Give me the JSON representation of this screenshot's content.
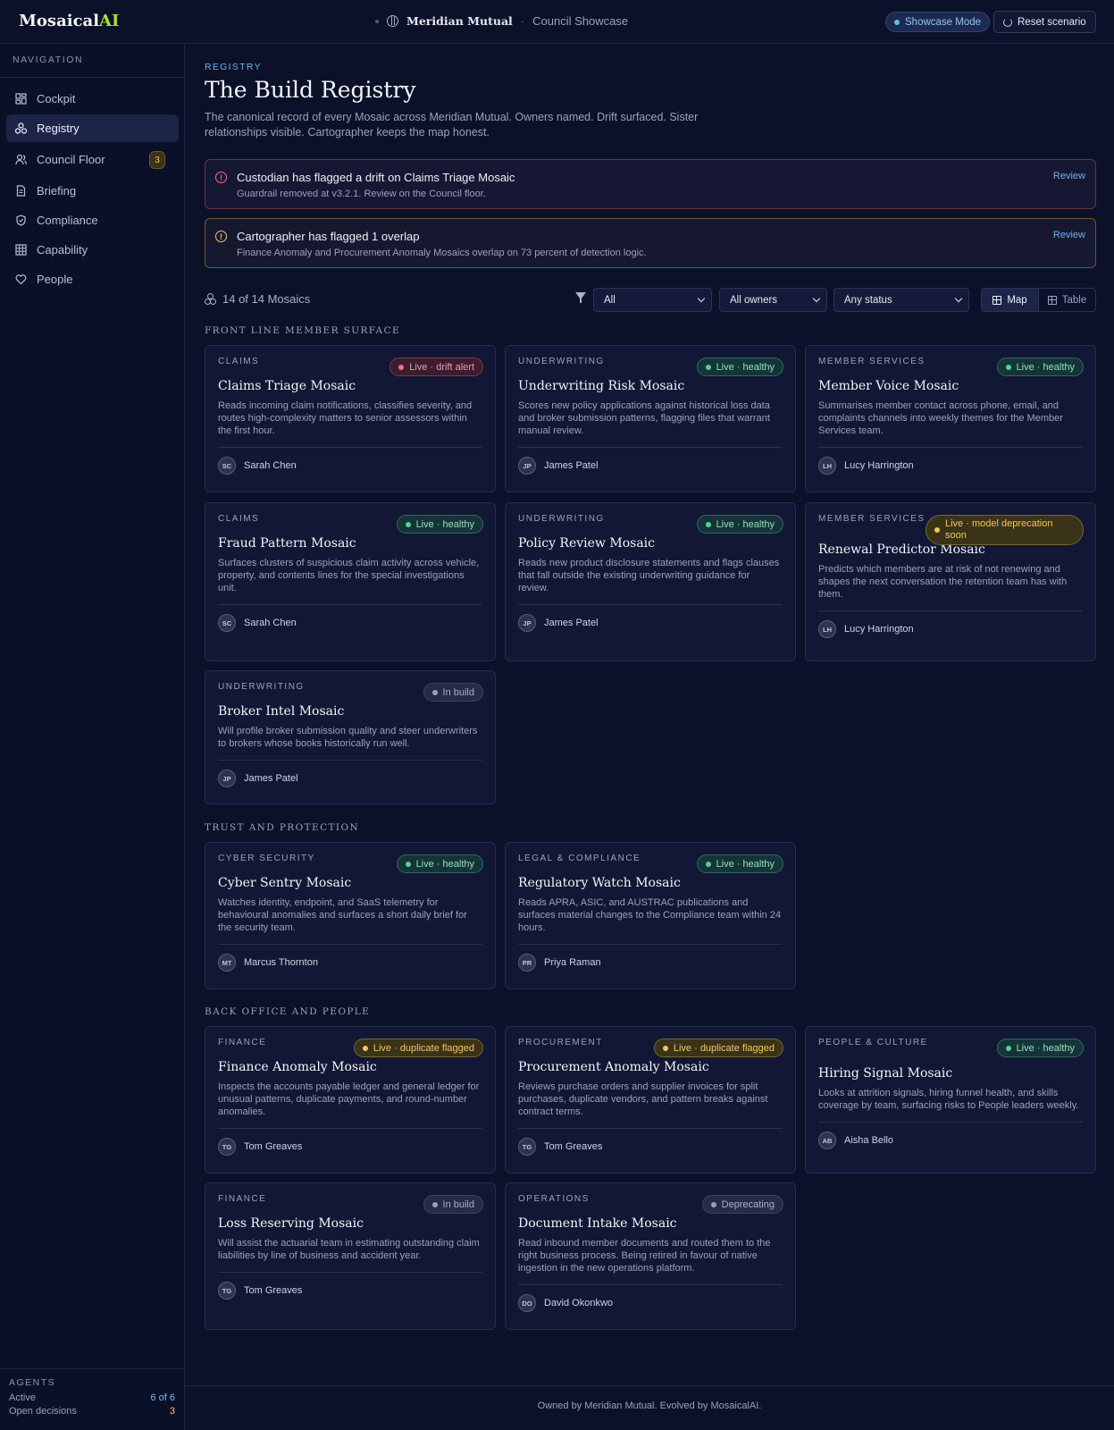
{
  "app": {
    "logo_main": "Mosaical",
    "logo_accent": "AI",
    "org": "Meridian Mutual",
    "section": "Council Showcase",
    "showcase_label": "Showcase Mode",
    "reset_label": "Reset scenario"
  },
  "sidebar": {
    "heading": "NAVIGATION",
    "items": [
      {
        "label": "Cockpit",
        "icon": "dashboard-icon"
      },
      {
        "label": "Registry",
        "icon": "network-icon"
      },
      {
        "label": "Council Floor",
        "icon": "users-icon",
        "badge": "3"
      },
      {
        "label": "Briefing",
        "icon": "document-icon"
      },
      {
        "label": "Compliance",
        "icon": "shield-icon"
      },
      {
        "label": "Capability",
        "icon": "grid-icon"
      },
      {
        "label": "People",
        "icon": "heart-icon"
      }
    ],
    "agents": {
      "heading": "AGENTS",
      "active_label": "Active",
      "active_value": "6 of 6",
      "open_label": "Open decisions",
      "open_value": "3"
    }
  },
  "page": {
    "kicker": "REGISTRY",
    "title": "The Build Registry",
    "subtitle": "The canonical record of every Mosaic across Meridian Mutual. Owners named. Drift surfaced. Sister relationships visible. Cartographer keeps the map honest."
  },
  "alerts": [
    {
      "title": "Custodian has flagged a drift on Claims Triage Mosaic",
      "detail": "Guardrail removed at v3.2.1. Review on the Council floor.",
      "action": "Review"
    },
    {
      "title": "Cartographer has flagged 1 overlap",
      "detail": "Finance Anomaly and Procurement Anomaly Mosaics overlap on 73 percent of detection logic.",
      "action": "Review"
    }
  ],
  "toolbar": {
    "count": "14 of 14 Mosaics",
    "filter_domain": "All",
    "filter_owner": "All owners",
    "filter_status": "Any status",
    "view_map": "Map",
    "view_table": "Table"
  },
  "sections": [
    "FRONT LINE MEMBER SURFACE",
    "TRUST AND PROTECTION",
    "BACK OFFICE AND PEOPLE"
  ],
  "cards": [
    {
      "category": "CLAIMS",
      "status": "Live · drift alert",
      "name": "Claims Triage Mosaic",
      "desc": "Reads incoming claim notifications, classifies severity, and routes high-complexity matters to senior assessors within the first hour.",
      "initials": "SC",
      "owner": "Sarah Chen"
    },
    {
      "category": "UNDERWRITING",
      "status": "Live · healthy",
      "name": "Underwriting Risk Mosaic",
      "desc": "Scores new policy applications against historical loss data and broker submission patterns, flagging files that warrant manual review.",
      "initials": "JP",
      "owner": "James Patel"
    },
    {
      "category": "MEMBER SERVICES",
      "status": "Live · healthy",
      "name": "Member Voice Mosaic",
      "desc": "Summarises member contact across phone, email, and complaints channels into weekly themes for the Member Services team.",
      "initials": "LH",
      "owner": "Lucy Harrington"
    },
    {
      "category": "CLAIMS",
      "status": "Live · healthy",
      "name": "Fraud Pattern Mosaic",
      "desc": "Surfaces clusters of suspicious claim activity across vehicle, property, and contents lines for the special investigations unit.",
      "initials": "SC",
      "owner": "Sarah Chen"
    },
    {
      "category": "UNDERWRITING",
      "status": "Live · healthy",
      "name": "Policy Review Mosaic",
      "desc": "Reads new product disclosure statements and flags clauses that fall outside the existing underwriting guidance for review.",
      "initials": "JP",
      "owner": "James Patel"
    },
    {
      "category": "MEMBER SERVICES",
      "status": "Live · model deprecation soon",
      "name": "Renewal Predictor Mosaic",
      "desc": "Predicts which members are at risk of not renewing and shapes the next conversation the retention team has with them.",
      "initials": "LH",
      "owner": "Lucy Harrington"
    },
    {
      "category": "UNDERWRITING",
      "status": "In build",
      "name": "Broker Intel Mosaic",
      "desc": "Will profile broker submission quality and steer underwriters to brokers whose books historically run well.",
      "initials": "JP",
      "owner": "James Patel"
    },
    {
      "category": "CYBER SECURITY",
      "status": "Live · healthy",
      "name": "Cyber Sentry Mosaic",
      "desc": "Watches identity, endpoint, and SaaS telemetry for behavioural anomalies and surfaces a short daily brief for the security team.",
      "initials": "MT",
      "owner": "Marcus Thornton"
    },
    {
      "category": "LEGAL & COMPLIANCE",
      "status": "Live · healthy",
      "name": "Regulatory Watch Mosaic",
      "desc": "Reads APRA, ASIC, and AUSTRAC publications and surfaces material changes to the Compliance team within 24 hours.",
      "initials": "PR",
      "owner": "Priya Raman"
    },
    {
      "category": "FINANCE",
      "status": "Live · duplicate flagged",
      "name": "Finance Anomaly Mosaic",
      "desc": "Inspects the accounts payable ledger and general ledger for unusual patterns, duplicate payments, and round-number anomalies.",
      "initials": "TG",
      "owner": "Tom Greaves"
    },
    {
      "category": "PROCUREMENT",
      "status": "Live · duplicate flagged",
      "name": "Procurement Anomaly Mosaic",
      "desc": "Reviews purchase orders and supplier invoices for split purchases, duplicate vendors, and pattern breaks against contract terms.",
      "initials": "TG",
      "owner": "Tom Greaves"
    },
    {
      "category": "PEOPLE & CULTURE",
      "status": "Live · healthy",
      "name": "Hiring Signal Mosaic",
      "desc": "Looks at attrition signals, hiring funnel health, and skills coverage by team, surfacing risks to People leaders weekly.",
      "initials": "AB",
      "owner": "Aisha Bello"
    },
    {
      "category": "FINANCE",
      "status": "In build",
      "name": "Loss Reserving Mosaic",
      "desc": "Will assist the actuarial team in estimating outstanding claim liabilities by line of business and accident year.",
      "initials": "TG",
      "owner": "Tom Greaves"
    },
    {
      "category": "OPERATIONS",
      "status": "Deprecating",
      "name": "Document Intake Mosaic",
      "desc": "Read inbound member documents and routed them to the right business process. Being retired in favour of native ingestion in the new operations platform.",
      "initials": "DO",
      "owner": "David Okonkwo"
    }
  ],
  "footer": "Owned by Meridian Mutual. Evolved by MosaicalAI."
}
